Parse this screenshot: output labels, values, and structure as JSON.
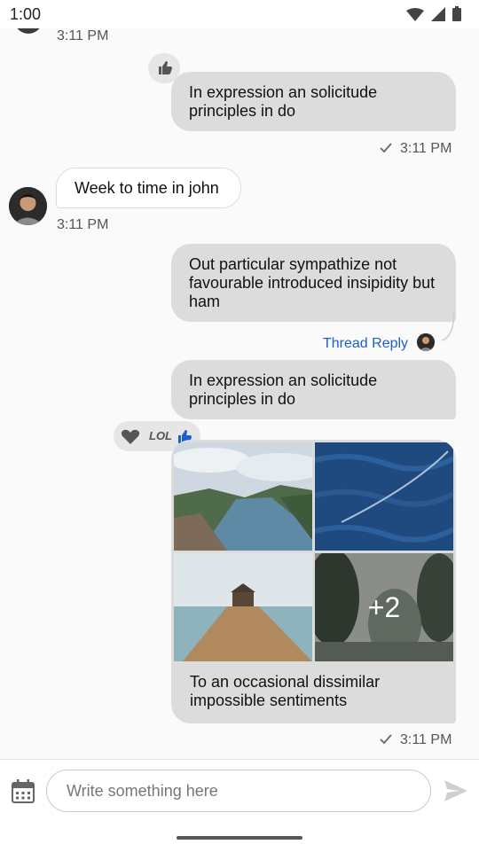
{
  "status_bar": {
    "time": "1:00"
  },
  "messages": {
    "ts_top": "3:11 PM",
    "m1": {
      "text": "In expression an solicitude principles in do",
      "time": "3:11 PM"
    },
    "m2": {
      "text": "Week to time in john",
      "time": "3:11 PM"
    },
    "m3": {
      "text": "Out particular sympathize not favourable introduced insipidity but ham",
      "thread_reply": "Thread Reply"
    },
    "m4": {
      "text": "In expression an solicitude principles in do"
    },
    "m5": {
      "more_count": "+2",
      "text": "To an occasional dissimilar impossible sentiments",
      "time": "3:11 PM"
    }
  },
  "reactions": {
    "lol_label": "LOL",
    "like_active_color": "#1a5fd0"
  },
  "composer": {
    "placeholder": "Write something here"
  },
  "icons": [
    "wifi-icon",
    "signal-icon",
    "battery-icon",
    "thumbs-up-icon",
    "checkmark-icon",
    "heart-icon",
    "calendar-icon",
    "send-icon"
  ]
}
